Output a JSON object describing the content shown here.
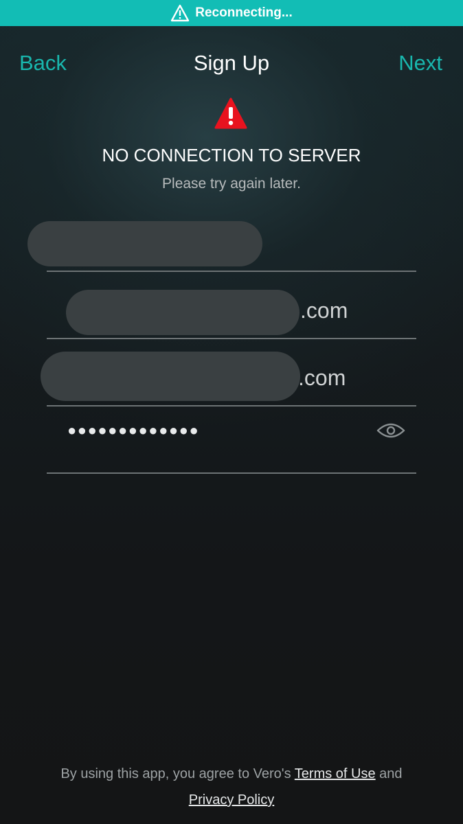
{
  "banner": {
    "icon": "warning-triangle-icon",
    "text": "Reconnecting...",
    "color": "#12bdb5"
  },
  "nav": {
    "back_label": "Back",
    "title": "Sign Up",
    "next_label": "Next",
    "accent_color": "#19b7ae"
  },
  "alert": {
    "icon": "warning-icon",
    "icon_color": "#e8131f",
    "title": "NO CONNECTION TO SERVER",
    "message": "Please try again later."
  },
  "form": {
    "name_field": {
      "value": ""
    },
    "email_field": {
      "suffix": ".com"
    },
    "confirm_email_field": {
      "suffix": ".com"
    },
    "password_field": {
      "masked_value": "●●●●●●●●●●●●●",
      "toggle_icon": "eye-icon"
    }
  },
  "footer": {
    "text_before": "By using this app, you agree to Vero's ",
    "terms_link": "Terms of Use",
    "text_between": " and",
    "privacy_link": "Privacy Policy"
  }
}
